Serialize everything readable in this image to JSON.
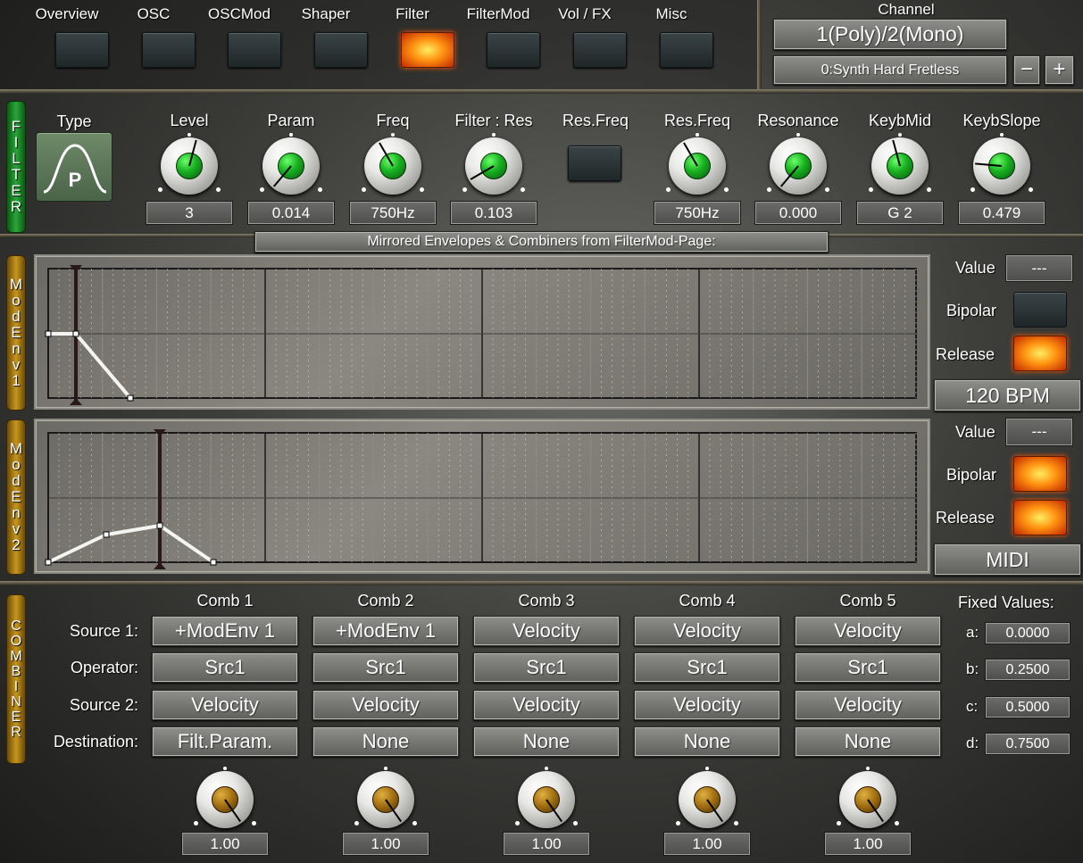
{
  "nav": {
    "items": [
      {
        "label": "Overview",
        "active": false
      },
      {
        "label": "OSC",
        "active": false
      },
      {
        "label": "OSCMod",
        "active": false
      },
      {
        "label": "Shaper",
        "active": false
      },
      {
        "label": "Filter",
        "active": true
      },
      {
        "label": "FilterMod",
        "active": false
      },
      {
        "label": "Vol / FX",
        "active": false
      },
      {
        "label": "Misc",
        "active": false
      }
    ]
  },
  "channel": {
    "label": "Channel",
    "mode": "1(Poly)/2(Mono)",
    "preset": "0:Synth Hard Fretless",
    "minus": "−",
    "plus": "+"
  },
  "filter": {
    "tab": [
      "F",
      "I",
      "L",
      "T",
      "E",
      "R"
    ],
    "type_label": "Type",
    "type_icon": "bandpass-curve-icon",
    "type_glyph": "P",
    "controls": [
      {
        "label": "Level",
        "value": "3",
        "pointer_deg": 195
      },
      {
        "label": "Param",
        "value": "0.014",
        "pointer_deg": 40
      },
      {
        "label": "Freq",
        "value": "750Hz",
        "pointer_deg": 150
      },
      {
        "label": "Filter : Res",
        "value": "0.103",
        "pointer_deg": 60
      },
      {
        "label": "Res.Freq",
        "value": "",
        "pointer_deg": null
      },
      {
        "label": "Res.Freq",
        "value": "750Hz",
        "pointer_deg": 150
      },
      {
        "label": "Resonance",
        "value": "0.000",
        "pointer_deg": 40
      },
      {
        "label": "KeybMid",
        "value": "G 2",
        "pointer_deg": 165
      },
      {
        "label": "KeybSlope",
        "value": "0.479",
        "pointer_deg": 95
      }
    ]
  },
  "mirrored_title": "Mirrored Envelopes & Combiners from FilterMod-Page:",
  "env1": {
    "tab": [
      "M",
      "o",
      "d",
      "E",
      "n",
      "v",
      "1"
    ],
    "value_label": "Value",
    "value": "---",
    "bipolar_label": "Bipolar",
    "bipolar_on": false,
    "release_label": "Release",
    "release_on": true,
    "sync": "120 BPM"
  },
  "env2": {
    "tab": [
      "M",
      "o",
      "d",
      "E",
      "n",
      "v",
      "2"
    ],
    "value_label": "Value",
    "value": "---",
    "bipolar_label": "Bipolar",
    "bipolar_on": true,
    "release_label": "Release",
    "release_on": true,
    "sync": "MIDI"
  },
  "combiner": {
    "tab": [
      "C",
      "O",
      "M",
      "B",
      "I",
      "N",
      "E",
      "R"
    ],
    "row_labels": [
      "Source 1:",
      "Operator:",
      "Source 2:",
      "Destination:"
    ],
    "columns": [
      {
        "title": "Comb 1",
        "source1": "+ModEnv 1",
        "operator": "Src1",
        "source2": "Velocity",
        "destination": "Filt.Param.",
        "amount": "1.00"
      },
      {
        "title": "Comb 2",
        "source1": "+ModEnv 1",
        "operator": "Src1",
        "source2": "Velocity",
        "destination": "None",
        "amount": "1.00"
      },
      {
        "title": "Comb 3",
        "source1": "Velocity",
        "operator": "Src1",
        "source2": "Velocity",
        "destination": "None",
        "amount": "1.00"
      },
      {
        "title": "Comb 4",
        "source1": "Velocity",
        "operator": "Src1",
        "source2": "Velocity",
        "destination": "None",
        "amount": "1.00"
      },
      {
        "title": "Comb 5",
        "source1": "Velocity",
        "operator": "Src1",
        "source2": "Velocity",
        "destination": "None",
        "amount": "1.00"
      }
    ],
    "fixed_title": "Fixed Values:",
    "fixed": [
      {
        "label": "a:",
        "value": "0.0000"
      },
      {
        "label": "b:",
        "value": "0.2500"
      },
      {
        "label": "c:",
        "value": "0.5000"
      },
      {
        "label": "d:",
        "value": "0.7500"
      }
    ]
  }
}
